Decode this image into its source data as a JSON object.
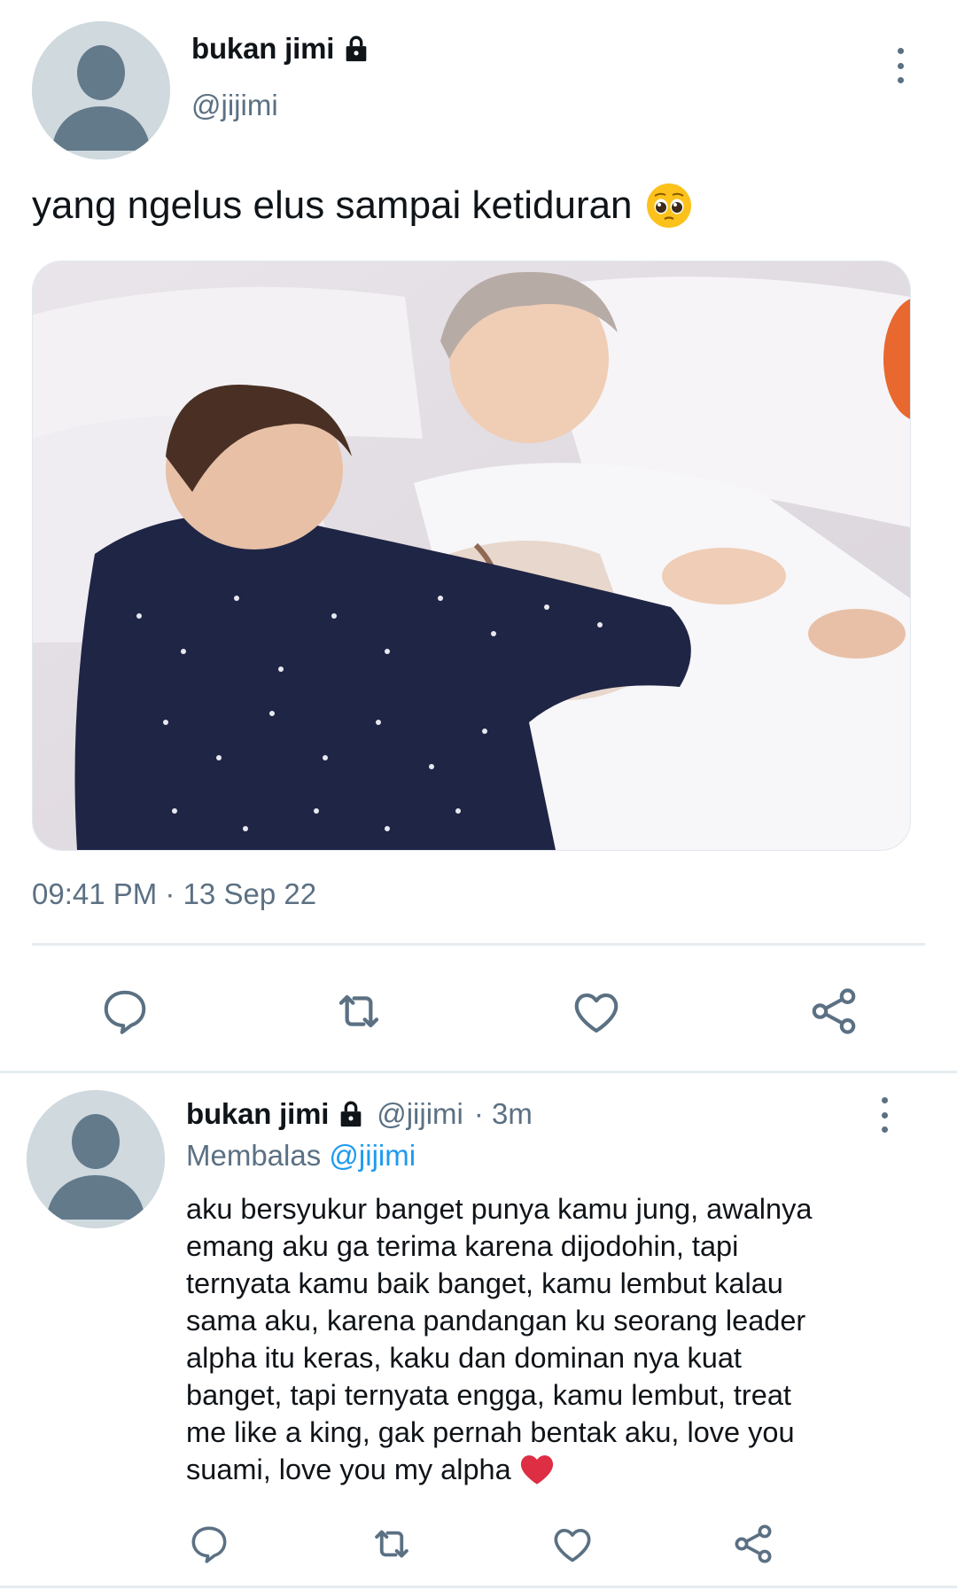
{
  "colors": {
    "text_primary": "#0f1419",
    "text_secondary": "#5b7083",
    "link": "#1d9bf0",
    "divider": "#e6ecf0",
    "avatar_bg": "#cfd9de",
    "avatar_figure": "#637a8b"
  },
  "main_tweet": {
    "author": {
      "name": "bukan jimi",
      "handle": "@jijimi",
      "protected_icon": "lock-icon"
    },
    "text": "yang ngelus elus sampai ketiduran",
    "text_emoji": "pleading-face-emoji",
    "media_alt_icon": "photo-two-people-sleeping-on-bed",
    "timestamp": "09:41 PM · 13 Sep 22",
    "actions": [
      "reply-icon",
      "retweet-icon",
      "like-icon",
      "share-icon"
    ]
  },
  "reply_tweet": {
    "author": {
      "name": "bukan jimi",
      "handle": "@jijimi",
      "protected_icon": "lock-icon"
    },
    "time_ago": "· 3m",
    "replying_prefix": "Membalas",
    "replying_to": "@jijimi",
    "text": "aku bersyukur banget punya kamu jung, awalnya\nemang aku ga terima karena dijodohin, tapi\nternyata kamu baik banget, kamu lembut kalau\nsama aku, karena pandangan ku seorang leader\nalpha itu keras, kaku dan dominan nya kuat\nbanget, tapi ternyata engga, kamu lembut, treat\nme like a king, gak pernah bentak aku, love you\nsuami, love you my alpha",
    "text_emoji": "red-heart-emoji",
    "actions": [
      "reply-icon",
      "retweet-icon",
      "like-icon",
      "share-icon"
    ]
  }
}
